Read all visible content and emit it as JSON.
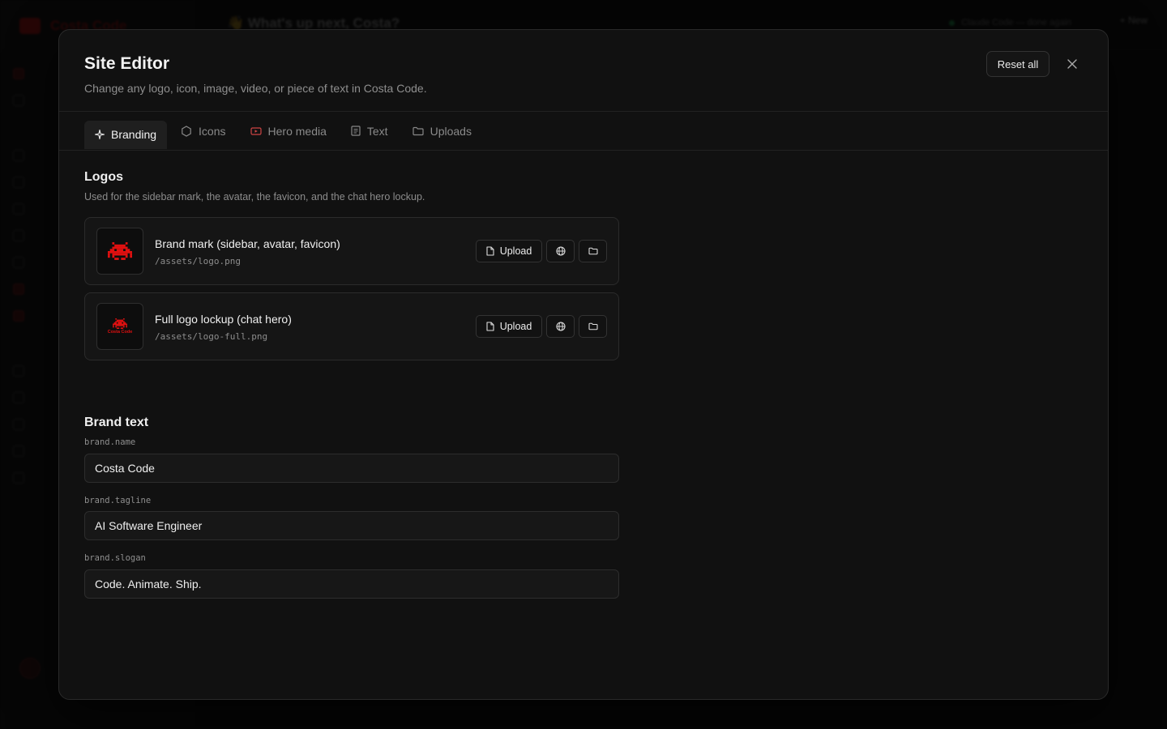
{
  "background": {
    "brand_name": "Costa Code",
    "greeting": "👋 What's up next, Costa?",
    "model_label": "Claude Code — done again",
    "new_label": "+ New"
  },
  "modal": {
    "title": "Site Editor",
    "subtitle": "Change any logo, icon, image, video, or piece of text in Costa Code.",
    "reset_label": "Reset all",
    "tabs": [
      {
        "label": "Branding",
        "icon": "sparkle-icon",
        "active": true
      },
      {
        "label": "Icons",
        "icon": "shapes-icon",
        "active": false
      },
      {
        "label": "Hero media",
        "icon": "video-icon",
        "active": false
      },
      {
        "label": "Text",
        "icon": "document-icon",
        "active": false
      },
      {
        "label": "Uploads",
        "icon": "folder-icon",
        "active": false
      }
    ],
    "logos": {
      "heading": "Logos",
      "description": "Used for the sidebar mark, the avatar, the favicon, and the chat hero lockup.",
      "items": [
        {
          "name": "Brand mark (sidebar, avatar, favicon)",
          "path": "/assets/logo.png",
          "upload_label": "Upload"
        },
        {
          "name": "Full logo lockup (chat hero)",
          "path": "/assets/logo-full.png",
          "upload_label": "Upload",
          "thumb_text": "Costa Code"
        }
      ]
    },
    "brand_text": {
      "heading": "Brand text",
      "fields": [
        {
          "key": "brand.name",
          "value": "Costa Code"
        },
        {
          "key": "brand.tagline",
          "value": "AI Software Engineer"
        },
        {
          "key": "brand.slogan",
          "value": "Code. Animate. Ship."
        }
      ]
    }
  },
  "colors": {
    "brand_red": "#e01010",
    "modal_bg": "#111111",
    "accent_green": "#22cc66"
  }
}
